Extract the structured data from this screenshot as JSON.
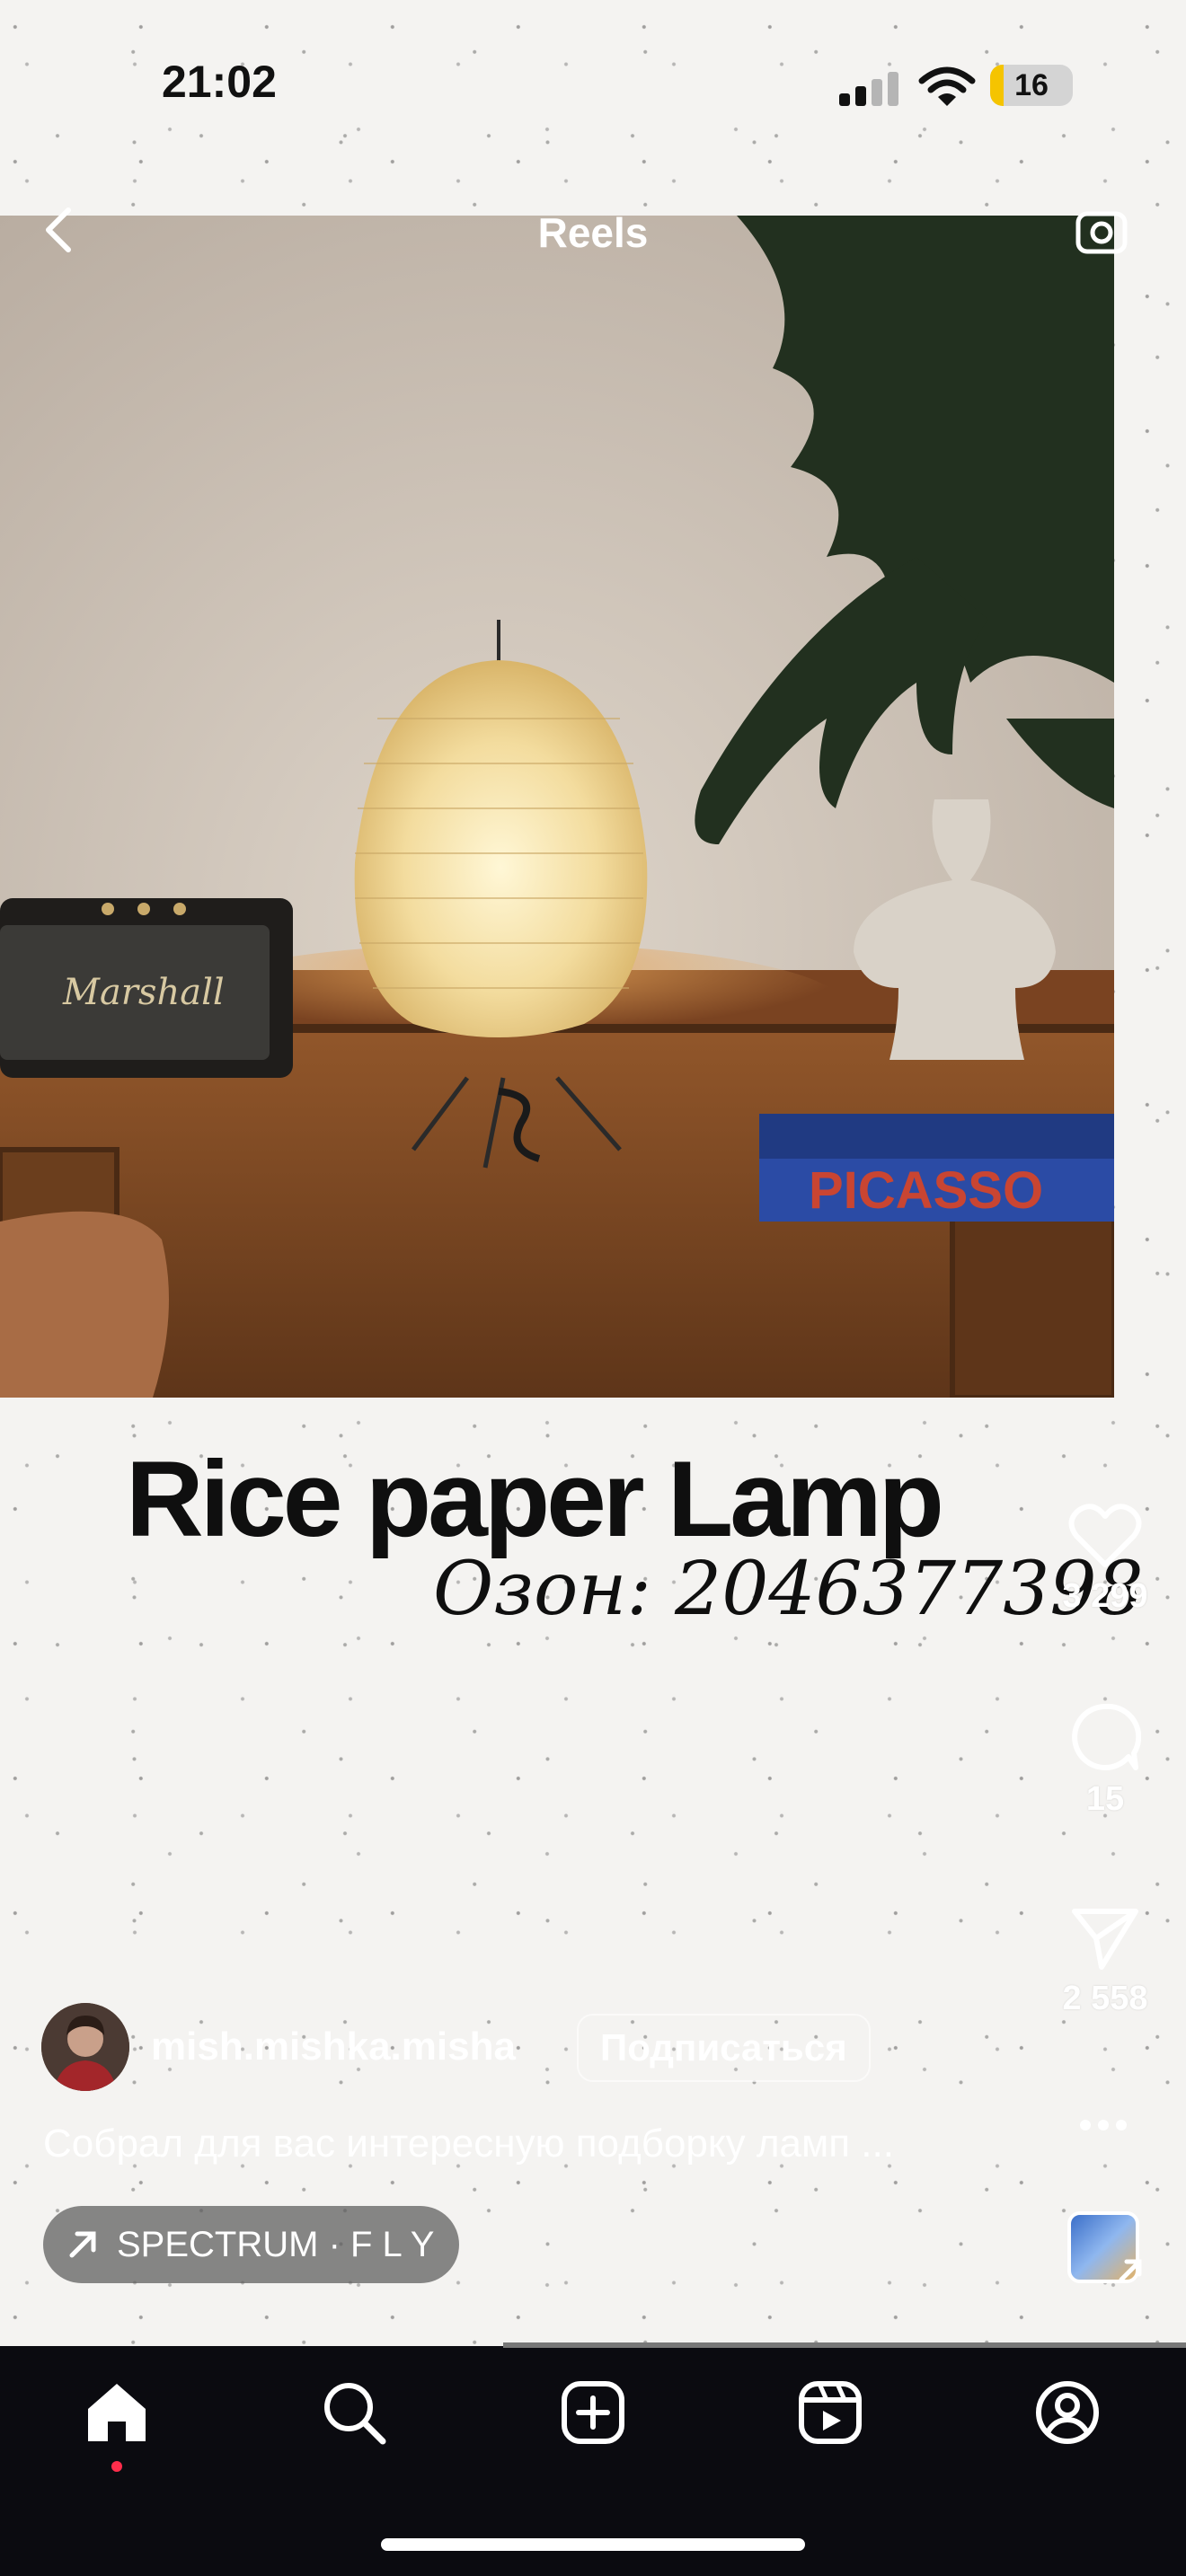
{
  "status_bar": {
    "time": "21:02",
    "battery": "16",
    "icons": [
      "cellular-signal-icon",
      "wifi-icon",
      "battery-icon"
    ]
  },
  "header": {
    "title": "Reels",
    "left_icon": "chevron-left-icon",
    "right_icon": "camera-icon"
  },
  "photo": {
    "speaker_brand": "Marshall",
    "book_title": "PICASSO"
  },
  "overlay": {
    "title": "Rice paper Lamp",
    "subtitle": "Озон: 2046377398"
  },
  "actions": {
    "like_count": "3 299",
    "comment_count": "15",
    "share_count": "2 558",
    "icons": [
      "heart-icon",
      "comment-icon",
      "send-icon",
      "more-icon"
    ]
  },
  "author": {
    "username": "mish.mishka.misha",
    "subscribe_label": "Подписаться"
  },
  "caption": "Собрал для вас интересную подборку ламп ...",
  "music": {
    "label": "SPECTRUM · F L Y",
    "icon": "arrow-up-right-icon"
  },
  "nav": {
    "items": [
      "home-icon",
      "search-icon",
      "create-icon",
      "reels-icon",
      "profile-icon"
    ],
    "active": "home-icon"
  },
  "colors": {
    "nav_background": "#0b0b10",
    "active_dot": "#ff2d4b",
    "battery_fill": "#f5c400"
  }
}
